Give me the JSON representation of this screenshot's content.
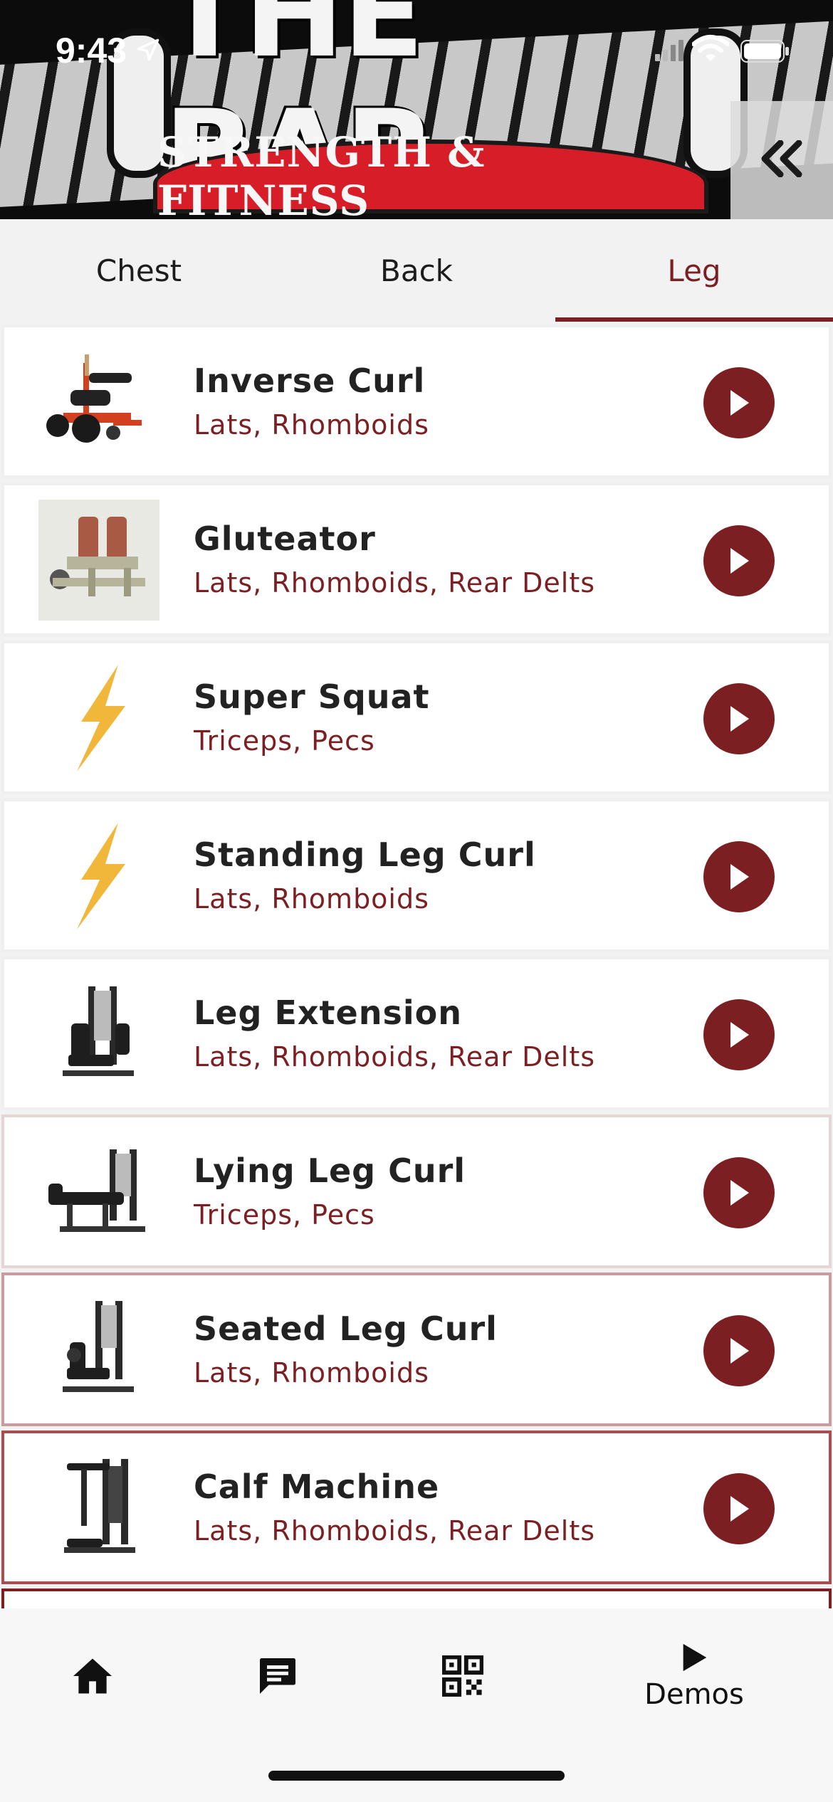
{
  "status_bar": {
    "time": "9:43"
  },
  "header": {
    "logo_title": "THE BAR",
    "logo_subtitle": "STRENGTH & FITNESS",
    "collapse_icon": "double-chevron-left-icon"
  },
  "tabs": [
    {
      "label": "Chest",
      "active": false
    },
    {
      "label": "Back",
      "active": false
    },
    {
      "label": "Leg",
      "active": true
    }
  ],
  "exercises": [
    {
      "name": "Inverse Curl",
      "muscles": "Lats, Rhomboids",
      "thumb": "machine-photo-red"
    },
    {
      "name": "Gluteator",
      "muscles": "Lats, Rhomboids, Rear Delts",
      "thumb": "machine-photo-beige"
    },
    {
      "name": "Super Squat",
      "muscles": "Triceps, Pecs",
      "thumb": "lightning-icon"
    },
    {
      "name": "Standing Leg Curl",
      "muscles": "Lats, Rhomboids",
      "thumb": "lightning-icon"
    },
    {
      "name": "Leg Extension",
      "muscles": "Lats, Rhomboids, Rear Delts",
      "thumb": "machine-photo-dark"
    },
    {
      "name": "Lying Leg Curl",
      "muscles": "Triceps, Pecs",
      "thumb": "machine-photo-dark"
    },
    {
      "name": "Seated Leg Curl",
      "muscles": "Lats, Rhomboids",
      "thumb": "machine-photo-dark"
    },
    {
      "name": "Calf Machine",
      "muscles": "Lats, Rhomboids, Rear Delts",
      "thumb": "machine-photo-dark"
    }
  ],
  "bottom_nav": {
    "items": [
      {
        "icon": "home-icon",
        "label": ""
      },
      {
        "icon": "chat-icon",
        "label": ""
      },
      {
        "icon": "qr-code-icon",
        "label": ""
      },
      {
        "icon": "play-icon",
        "label": "Demos"
      }
    ]
  },
  "colors": {
    "accent": "#7b1f22",
    "row_bg": "#ffffff",
    "page_bg": "#f2f2f2",
    "lightning": "#f0b73a"
  }
}
